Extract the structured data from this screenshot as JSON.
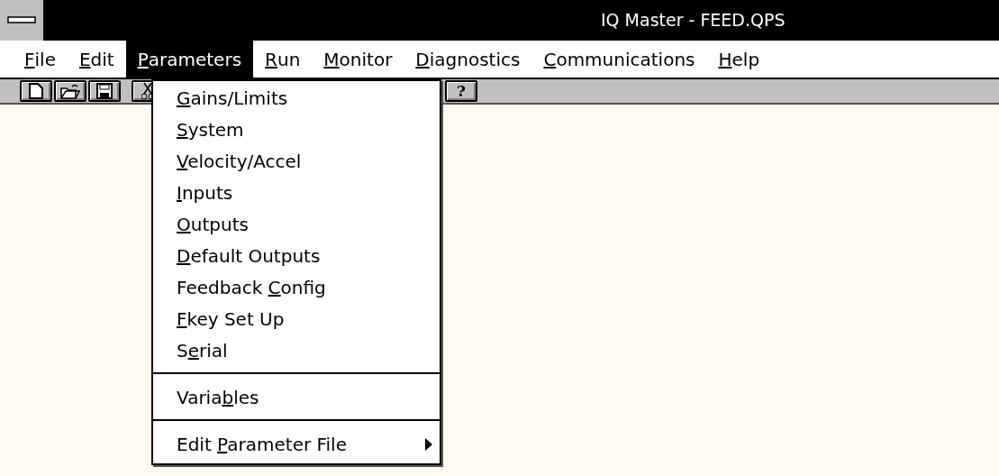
{
  "window": {
    "title": "IQ Master - FEED.QPS"
  },
  "menubar": [
    {
      "key": "F",
      "after": "ile",
      "selected": false
    },
    {
      "key": "E",
      "after": "dit",
      "selected": false
    },
    {
      "key": "P",
      "after": "arameters",
      "selected": true
    },
    {
      "key": "R",
      "after": "un",
      "selected": false
    },
    {
      "key": "M",
      "after": "onitor",
      "selected": false
    },
    {
      "key": "D",
      "after": "iagnostics",
      "selected": false
    },
    {
      "key": "C",
      "after": "ommunications",
      "selected": false
    },
    {
      "key": "H",
      "after": "elp",
      "selected": false
    }
  ],
  "dropdown": [
    {
      "kind": "item",
      "key": "G",
      "after": "ains/Limits"
    },
    {
      "kind": "item",
      "key": "S",
      "after": "ystem"
    },
    {
      "kind": "item",
      "key": "V",
      "after": "elocity/Accel"
    },
    {
      "kind": "item",
      "key": "I",
      "after": "nputs"
    },
    {
      "kind": "item",
      "key": "O",
      "after": "utputs"
    },
    {
      "kind": "item",
      "key": "D",
      "after": "efault Outputs"
    },
    {
      "kind": "item",
      "before": "Feedback ",
      "key": "C",
      "after": "onfig"
    },
    {
      "kind": "item",
      "key": "F",
      "after": "key Set Up"
    },
    {
      "kind": "item",
      "before": "S",
      "key": "e",
      "after": "rial"
    },
    {
      "kind": "separator"
    },
    {
      "kind": "item",
      "before": "Varia",
      "key": "b",
      "after": "les"
    },
    {
      "kind": "separator"
    },
    {
      "kind": "item",
      "before": "Edit ",
      "key": "P",
      "after": "arameter File",
      "submenu": true
    }
  ],
  "toolbar": {
    "help_button": "?"
  }
}
